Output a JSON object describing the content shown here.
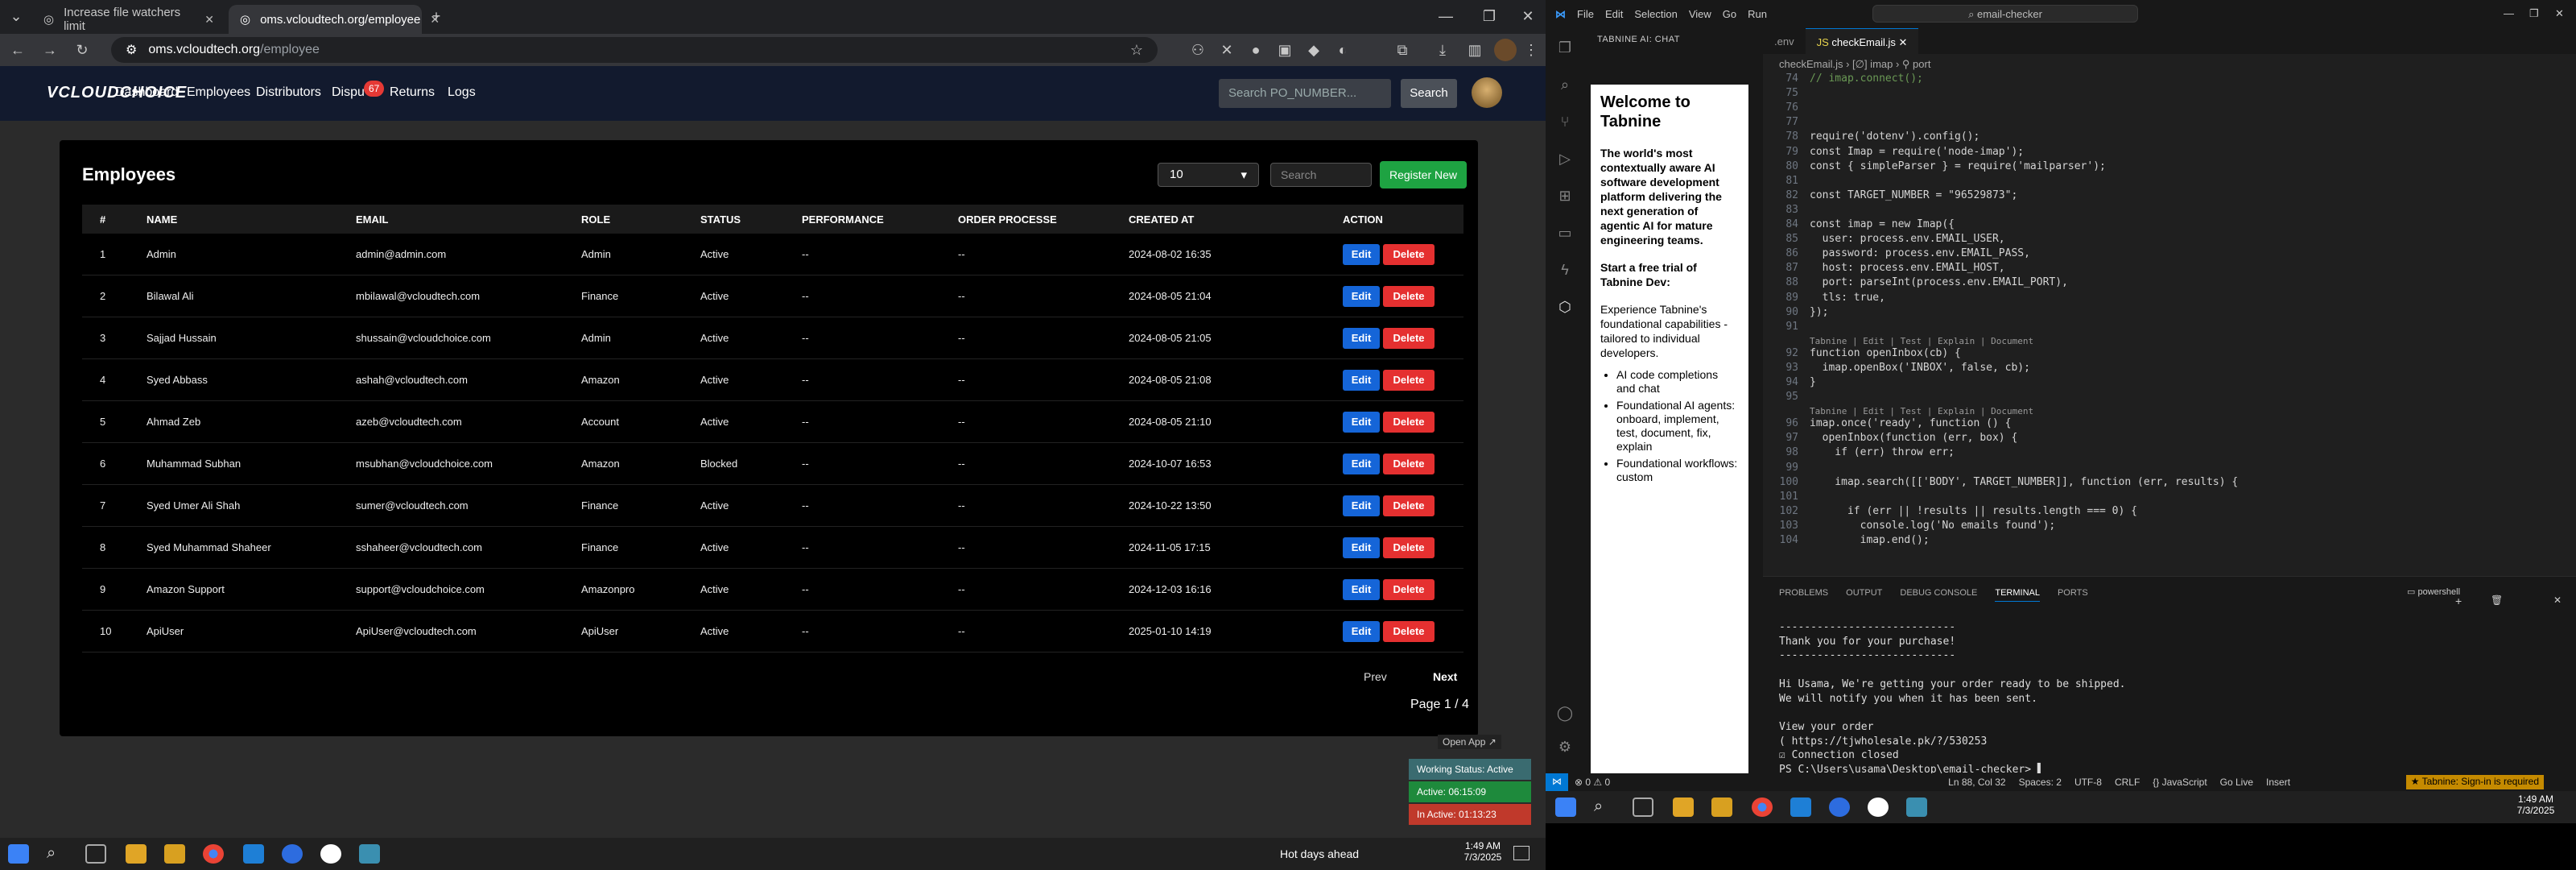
{
  "browser": {
    "tabs": [
      {
        "title": "Increase file watchers limit"
      },
      {
        "title": "oms.vcloudtech.org/employee"
      }
    ],
    "url_host": "oms.vcloudtech.org",
    "url_path": "/employee"
  },
  "site": {
    "logo": "VCLOUDCHOICE",
    "nav": [
      "Dashboard",
      "Employees",
      "Distributors",
      "Dispu",
      "Returns",
      "Logs"
    ],
    "dispute_badge": "67",
    "po_search_placeholder": "Search PO_NUMBER...",
    "po_search_button": "Search"
  },
  "employees": {
    "title": "Employees",
    "page_size": "10",
    "search_placeholder": "Search",
    "register_button": "Register New",
    "columns": [
      "#",
      "NAME",
      "EMAIL",
      "ROLE",
      "STATUS",
      "PERFORMANCE",
      "ORDER PROCESSE",
      "CREATED AT",
      "ACTION"
    ],
    "rows": [
      [
        "1",
        "Admin",
        "admin@admin.com",
        "Admin",
        "Active",
        "--",
        "--",
        "2024-08-02 16:35"
      ],
      [
        "2",
        "Bilawal Ali",
        "mbilawal@vcloudtech.com",
        "Finance",
        "Active",
        "--",
        "--",
        "2024-08-05 21:04"
      ],
      [
        "3",
        "Sajjad Hussain",
        "shussain@vcloudchoice.com",
        "Admin",
        "Active",
        "--",
        "--",
        "2024-08-05 21:05"
      ],
      [
        "4",
        "Syed Abbass",
        "ashah@vcloudtech.com",
        "Amazon",
        "Active",
        "--",
        "--",
        "2024-08-05 21:08"
      ],
      [
        "5",
        "Ahmad Zeb",
        "azeb@vcloudtech.com",
        "Account",
        "Active",
        "--",
        "--",
        "2024-08-05 21:10"
      ],
      [
        "6",
        "Muhammad Subhan",
        "msubhan@vcloudchoice.com",
        "Amazon",
        "Blocked",
        "--",
        "--",
        "2024-10-07 16:53"
      ],
      [
        "7",
        "Syed Umer Ali Shah",
        "sumer@vcloudtech.com",
        "Finance",
        "Active",
        "--",
        "--",
        "2024-10-22 13:50"
      ],
      [
        "8",
        "Syed Muhammad Shaheer",
        "sshaheer@vcloudtech.com",
        "Finance",
        "Active",
        "--",
        "--",
        "2024-11-05 17:15"
      ],
      [
        "9",
        "Amazon Support",
        "support@vcloudchoice.com",
        "Amazonpro",
        "Active",
        "--",
        "--",
        "2024-12-03 16:16"
      ],
      [
        "10",
        "ApiUser",
        "ApiUser@vcloudtech.com",
        "ApiUser",
        "Active",
        "--",
        "--",
        "2025-01-10 14:19"
      ]
    ],
    "edit_label": "Edit",
    "delete_label": "Delete",
    "prev": "Prev",
    "next": "Next",
    "page_info": "Page 1 / 4"
  },
  "widget": {
    "open_app": "Open App ↗",
    "working_status": "Working Status: Active",
    "active": "Active: 06:15:09",
    "inactive": "In Active: 01:13:23"
  },
  "left_taskbar": {
    "weather": "Hot days ahead",
    "time": "1:49 AM",
    "date": "7/3/2025"
  },
  "vscode": {
    "menu": [
      "File",
      "Edit",
      "Selection",
      "View",
      "Go",
      "Run"
    ],
    "command_center": "email-checker",
    "chat_header": "TABNINE AI: CHAT",
    "chat": {
      "heading": "Welcome to Tabnine",
      "lead": "The world's most contextually aware AI software development platform delivering the next generation of agentic AI for mature engineering teams.",
      "trial": "Start a free trial of Tabnine Dev:",
      "intro": "Experience Tabnine's foundational capabilities - tailored to individual developers.",
      "bullets": [
        "AI code completions and chat",
        "Foundational AI agents: onboard, implement, test, document, fix, explain",
        "Foundational workflows: custom"
      ]
    },
    "tabs": [
      ".env",
      "checkEmail.js"
    ],
    "breadcrumb": "checkEmail.js › [∅] imap › ⚲ port",
    "codelens": "Tabnine | Edit | Test | Explain | Document",
    "code": [
      {
        "n": "74",
        "t": "// imap.connect();"
      },
      {
        "n": "75",
        "t": ""
      },
      {
        "n": "76",
        "t": ""
      },
      {
        "n": "77",
        "t": ""
      },
      {
        "n": "78",
        "t": "require('dotenv').config();"
      },
      {
        "n": "79",
        "t": "const Imap = require('node-imap');"
      },
      {
        "n": "80",
        "t": "const { simpleParser } = require('mailparser');"
      },
      {
        "n": "81",
        "t": ""
      },
      {
        "n": "82",
        "t": "const TARGET_NUMBER = \"96529873\";"
      },
      {
        "n": "83",
        "t": ""
      },
      {
        "n": "84",
        "t": "const imap = new Imap({"
      },
      {
        "n": "85",
        "t": "  user: process.env.EMAIL_USER,"
      },
      {
        "n": "86",
        "t": "  password: process.env.EMAIL_PASS,"
      },
      {
        "n": "87",
        "t": "  host: process.env.EMAIL_HOST,"
      },
      {
        "n": "88",
        "t": "  port: parseInt(process.env.EMAIL_PORT),"
      },
      {
        "n": "89",
        "t": "  tls: true,"
      },
      {
        "n": "90",
        "t": "});"
      },
      {
        "n": "91",
        "t": ""
      },
      {
        "n": "92",
        "t": "function openInbox(cb) {"
      },
      {
        "n": "93",
        "t": "  imap.openBox('INBOX', false, cb);"
      },
      {
        "n": "94",
        "t": "}"
      },
      {
        "n": "95",
        "t": ""
      },
      {
        "n": "96",
        "t": "imap.once('ready', function () {"
      },
      {
        "n": "97",
        "t": "  openInbox(function (err, box) {"
      },
      {
        "n": "98",
        "t": "    if (err) throw err;"
      },
      {
        "n": "99",
        "t": ""
      },
      {
        "n": "100",
        "t": "    imap.search([['BODY', TARGET_NUMBER]], function (err, results) {"
      },
      {
        "n": "101",
        "t": ""
      },
      {
        "n": "102",
        "t": "      if (err || !results || results.length === 0) {"
      },
      {
        "n": "103",
        "t": "        console.log('No emails found');"
      },
      {
        "n": "104",
        "t": "        imap.end();"
      }
    ],
    "panel_tabs": [
      "PROBLEMS",
      "OUTPUT",
      "DEBUG CONSOLE",
      "TERMINAL",
      "PORTS"
    ],
    "shell": "powershell",
    "terminal": "----------------------------\nThank you for your purchase!\n----------------------------\n\nHi Usama, We're getting your order ready to be shipped.\nWe will notify you when it has been sent.\n\nView your order\n( https://tjwholesale.pk/?/530253\n☑ Connection closed\nPS C:\\Users\\usama\\Desktop\\email-checker> ▌",
    "status": {
      "left": "⊗ 0 ⚠ 0",
      "cursor": "Ln 88, Col 32",
      "spaces": "Spaces: 2",
      "encoding": "UTF-8",
      "eol": "CRLF",
      "lang": "{} JavaScript",
      "golive": "Go Live",
      "insert": "Insert",
      "tabnine": "★ Tabnine: Sign-in is required"
    },
    "time": "1:49 AM",
    "date": "7/3/2025"
  }
}
